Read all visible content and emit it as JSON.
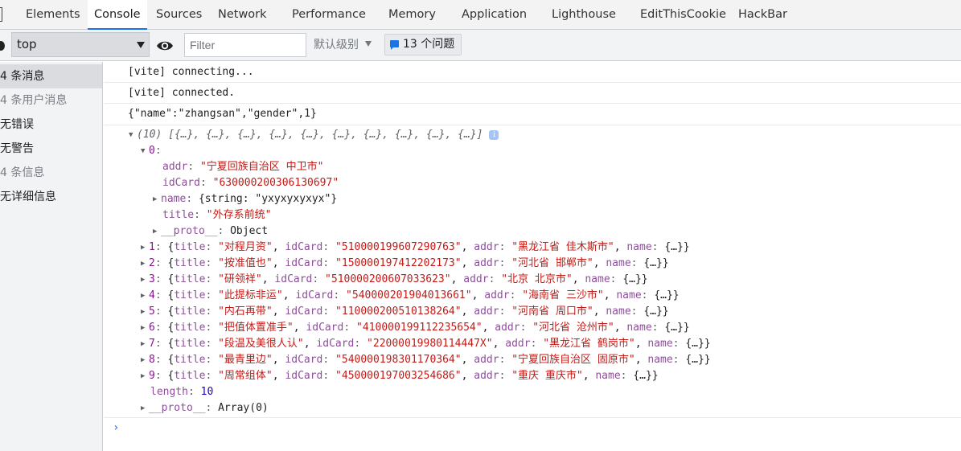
{
  "tabs": [
    {
      "label": "Elements"
    },
    {
      "label": "Console"
    },
    {
      "label": "Sources"
    },
    {
      "label": "Network"
    },
    {
      "label": "Performance"
    },
    {
      "label": "Memory"
    },
    {
      "label": "Application"
    },
    {
      "label": "Lighthouse"
    },
    {
      "label": "EditThisCookie"
    },
    {
      "label": "HackBar"
    }
  ],
  "toolbar": {
    "context": "top",
    "filter_placeholder": "Filter",
    "filter_value": "",
    "level_label": "默认级别",
    "issues_label": "13 个问题"
  },
  "sidebar": {
    "items": [
      {
        "label": "4 条消息"
      },
      {
        "label": "4 条用户消息"
      },
      {
        "label": "无错误"
      },
      {
        "label": "无警告"
      },
      {
        "label": "4 条信息"
      },
      {
        "label": "无详细信息"
      }
    ]
  },
  "console": {
    "messages": [
      {
        "text": "[vite] connecting..."
      },
      {
        "text": "[vite] connected."
      },
      {
        "text": "{\"name\":\"zhangsan\",\"gender\",1}"
      }
    ],
    "array": {
      "summary": "(10) [{…}, {…}, {…}, {…}, {…}, {…}, {…}, {…}, {…}, {…}]",
      "item0": {
        "index": "0",
        "addr": "\"宁夏回族自治区 中卫市\"",
        "idCard": "\"630000200306130697\"",
        "name": "{string: \"yxyxyxyxyx\"}",
        "title": "\"外存系前统\"",
        "proto": "Object"
      },
      "rows": [
        {
          "index": "1",
          "title": "\"对程月资\"",
          "idCard": "\"510000199607290763\"",
          "addr": "\"黑龙江省 佳木斯市\""
        },
        {
          "index": "2",
          "title": "\"按准值也\"",
          "idCard": "\"150000197412202173\"",
          "addr": "\"河北省 邯郸市\""
        },
        {
          "index": "3",
          "title": "\"研领祥\"",
          "idCard": "\"510000200607033623\"",
          "addr": "\"北京 北京市\""
        },
        {
          "index": "4",
          "title": "\"此提标非运\"",
          "idCard": "\"540000201904013661\"",
          "addr": "\"海南省 三沙市\""
        },
        {
          "index": "5",
          "title": "\"内石再带\"",
          "idCard": "\"110000200510138264\"",
          "addr": "\"河南省 周口市\""
        },
        {
          "index": "6",
          "title": "\"把值体置准手\"",
          "idCard": "\"410000199112235654\"",
          "addr": "\"河北省 沧州市\""
        },
        {
          "index": "7",
          "title": "\"段温及美很人认\"",
          "idCard": "\"22000019980114447X\"",
          "addr": "\"黑龙江省 鹤岗市\""
        },
        {
          "index": "8",
          "title": "\"最青里边\"",
          "idCard": "\"540000198301170364\"",
          "addr": "\"宁夏回族自治区 固原市\""
        },
        {
          "index": "9",
          "title": "\"周常组体\"",
          "idCard": "\"450000197003254686\"",
          "addr": "\"重庆 重庆市\""
        }
      ],
      "length": "10",
      "proto": "Array(0)"
    },
    "prompt": "›"
  }
}
